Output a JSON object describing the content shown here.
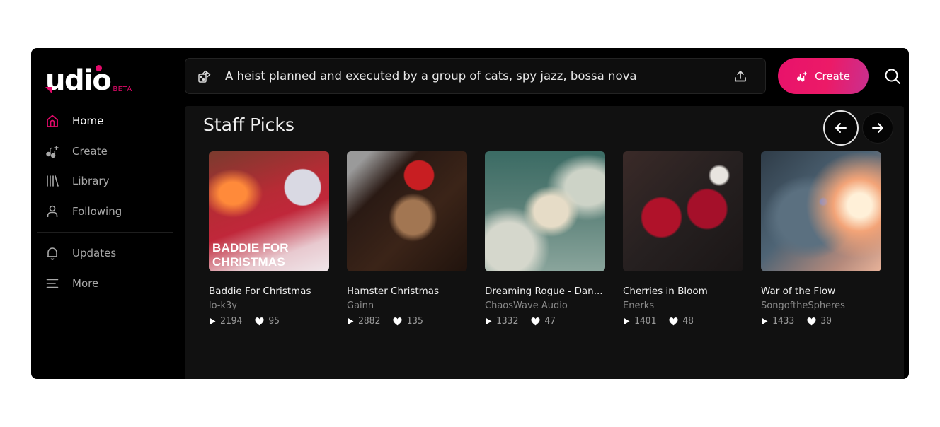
{
  "app": {
    "logo_text": "udio",
    "logo_badge": "BETA",
    "accent_color": "#e30a6a"
  },
  "sidebar": {
    "items": [
      {
        "label": "Home",
        "icon": "home-icon",
        "active": true
      },
      {
        "label": "Create",
        "icon": "music-plus-icon",
        "active": false
      },
      {
        "label": "Library",
        "icon": "library-icon",
        "active": false
      },
      {
        "label": "Following",
        "icon": "user-icon",
        "active": false
      }
    ],
    "secondary_items": [
      {
        "label": "Updates",
        "icon": "bell-icon"
      },
      {
        "label": "More",
        "icon": "menu-icon"
      }
    ]
  },
  "topbar": {
    "prompt_value": "A heist planned and executed by a group of cats, spy jazz, bossa nova",
    "random_icon": "dice-icon",
    "upload_icon": "upload-icon",
    "create_label": "Create",
    "search_icon": "search-icon"
  },
  "staff_picks": {
    "title": "Staff Picks",
    "prev_icon": "arrow-left-icon",
    "next_icon": "arrow-right-icon",
    "tracks": [
      {
        "title": "Baddie For Christmas",
        "artist": "lo-k3y",
        "plays": "2194",
        "likes": "95",
        "cover_text": "BADDIE FOR CHRISTMAS"
      },
      {
        "title": "Hamster Christmas",
        "artist": "Gainn",
        "plays": "2882",
        "likes": "135"
      },
      {
        "title": "Dreaming Rogue - Dan...",
        "artist": "ChaosWave Audio",
        "plays": "1332",
        "likes": "47"
      },
      {
        "title": "Cherries in Bloom",
        "artist": "Enerks",
        "plays": "1401",
        "likes": "48"
      },
      {
        "title": "War of the Flow",
        "artist": "SongoftheSpheres",
        "plays": "1433",
        "likes": "30"
      }
    ]
  }
}
